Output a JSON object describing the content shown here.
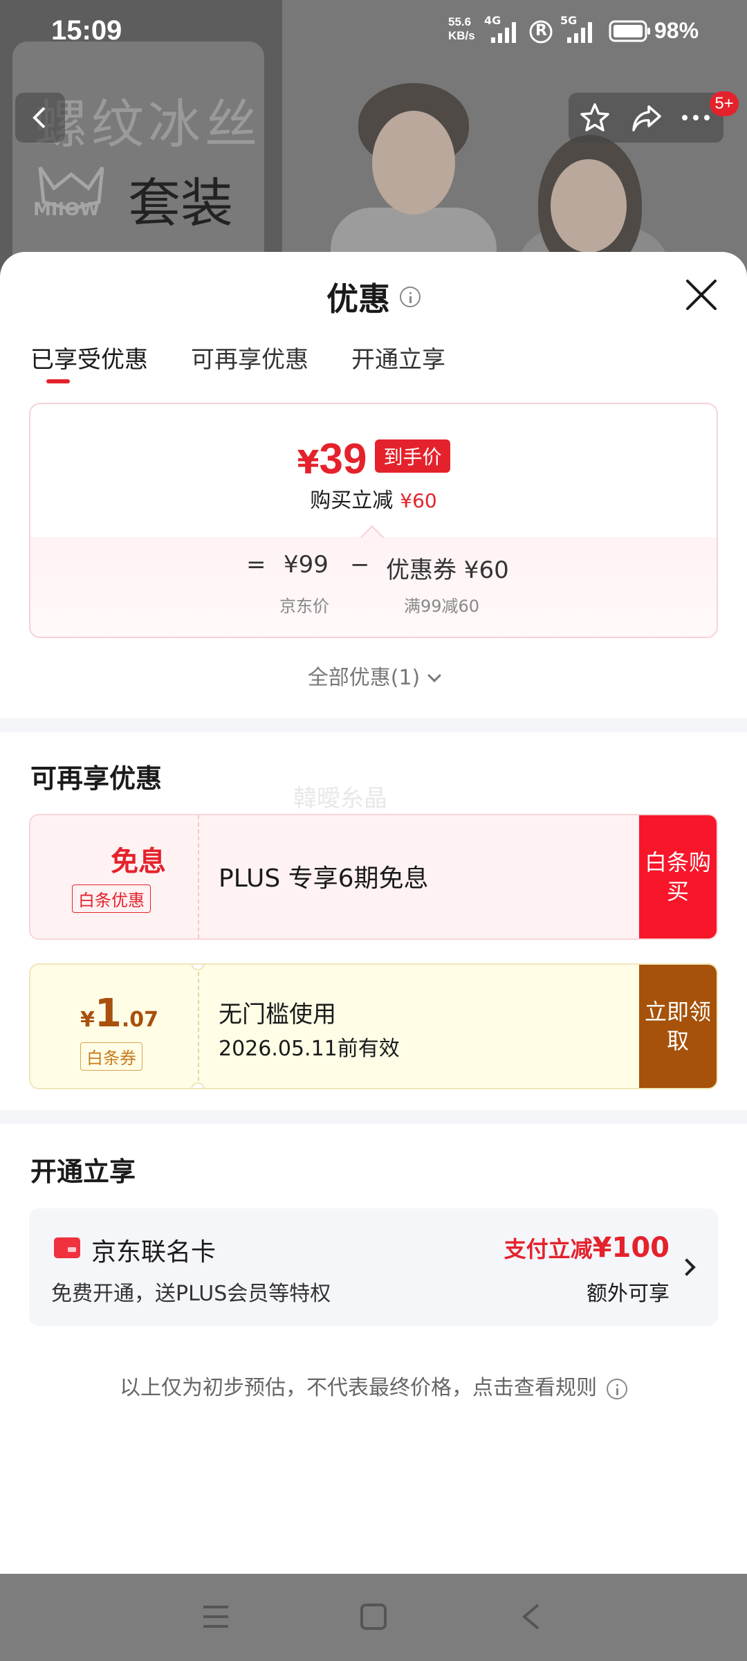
{
  "status_bar": {
    "time": "15:09",
    "net_speed_value": "55.6",
    "net_speed_unit": "KB/s",
    "network_4g": "4G",
    "network_5g": "5G",
    "registered_mark": "R",
    "battery": "98%"
  },
  "background": {
    "product_title": "螺纹冰丝",
    "brand": "MIIOW",
    "suit_label": "套装",
    "cart_badge": "5+"
  },
  "sheet": {
    "title": "优惠",
    "tabs": [
      {
        "label": "已享受优惠",
        "active": true
      },
      {
        "label": "可再享优惠",
        "active": false
      },
      {
        "label": "开通立享",
        "active": false
      }
    ],
    "price_card": {
      "currency": "¥",
      "final_price": "39",
      "final_tag": "到手价",
      "reduce_label": "购买立减",
      "reduce_amount": "¥60",
      "equals": "=",
      "base_price": "¥99",
      "minus": "−",
      "coupon_label": "优惠券 ¥60",
      "base_caption": "京东价",
      "coupon_caption": "满99减60"
    },
    "all_discounts": "全部优惠(1)",
    "section_more": {
      "title": "可再享优惠",
      "watermark": "韓曖糸晶",
      "coupon_interest": {
        "main": "免息",
        "sub": "白条优惠",
        "desc": "PLUS 专享6期免息",
        "action": "白条购买"
      },
      "coupon_baitiao": {
        "currency": "¥",
        "amount_int": "1",
        "amount_dec": ".07",
        "sub": "白条券",
        "desc1": "无门槛使用",
        "desc2": "2026.05.11前有效",
        "action": "立即领取"
      }
    },
    "section_open": {
      "title": "开通立享",
      "card_name": "京东联名卡",
      "card_desc": "免费开通，送PLUS会员等特权",
      "promo_prefix": "支付立减",
      "promo_amount": "¥100",
      "promo_extra": "额外可享"
    },
    "footnote": "以上仅为初步预估，不代表最终价格，点击查看规则"
  },
  "colors": {
    "accent_red": "#e4222c",
    "coupon_brown": "#a6520a",
    "divider": "#f3f5f9"
  }
}
